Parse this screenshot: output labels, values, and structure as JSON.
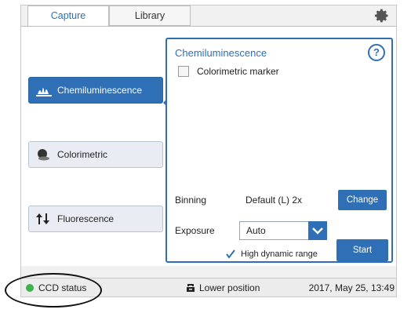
{
  "tabs": [
    {
      "label": "Capture",
      "active": true
    },
    {
      "label": "Library",
      "active": false
    }
  ],
  "settings_icon": "gear-icon",
  "modes": [
    {
      "label": "Chemiluminescence",
      "icon": "chemiluminescence-icon",
      "active": true
    },
    {
      "label": "Colorimetric",
      "icon": "colorimetric-icon",
      "active": false
    },
    {
      "label": "Fluorescence",
      "icon": "fluorescence-icon",
      "active": false
    }
  ],
  "panel": {
    "title": "Chemiluminescence",
    "help_label": "?",
    "colorimetric_marker": {
      "label": "Colorimetric marker",
      "checked": false
    },
    "binning": {
      "label": "Binning",
      "value": "Default (L) 2x",
      "button": "Change"
    },
    "exposure": {
      "label": "Exposure",
      "value": "Auto"
    },
    "high_dynamic_range": {
      "label": "High dynamic range",
      "checked": true
    },
    "start_button": "Start"
  },
  "status_bar": {
    "ccd_status": "CCD status",
    "ccd_status_color": "#3cb44b",
    "position": "Lower position",
    "datetime": "2017, May 25, 13:49"
  },
  "colors": {
    "accent": "#2f6fb6"
  }
}
